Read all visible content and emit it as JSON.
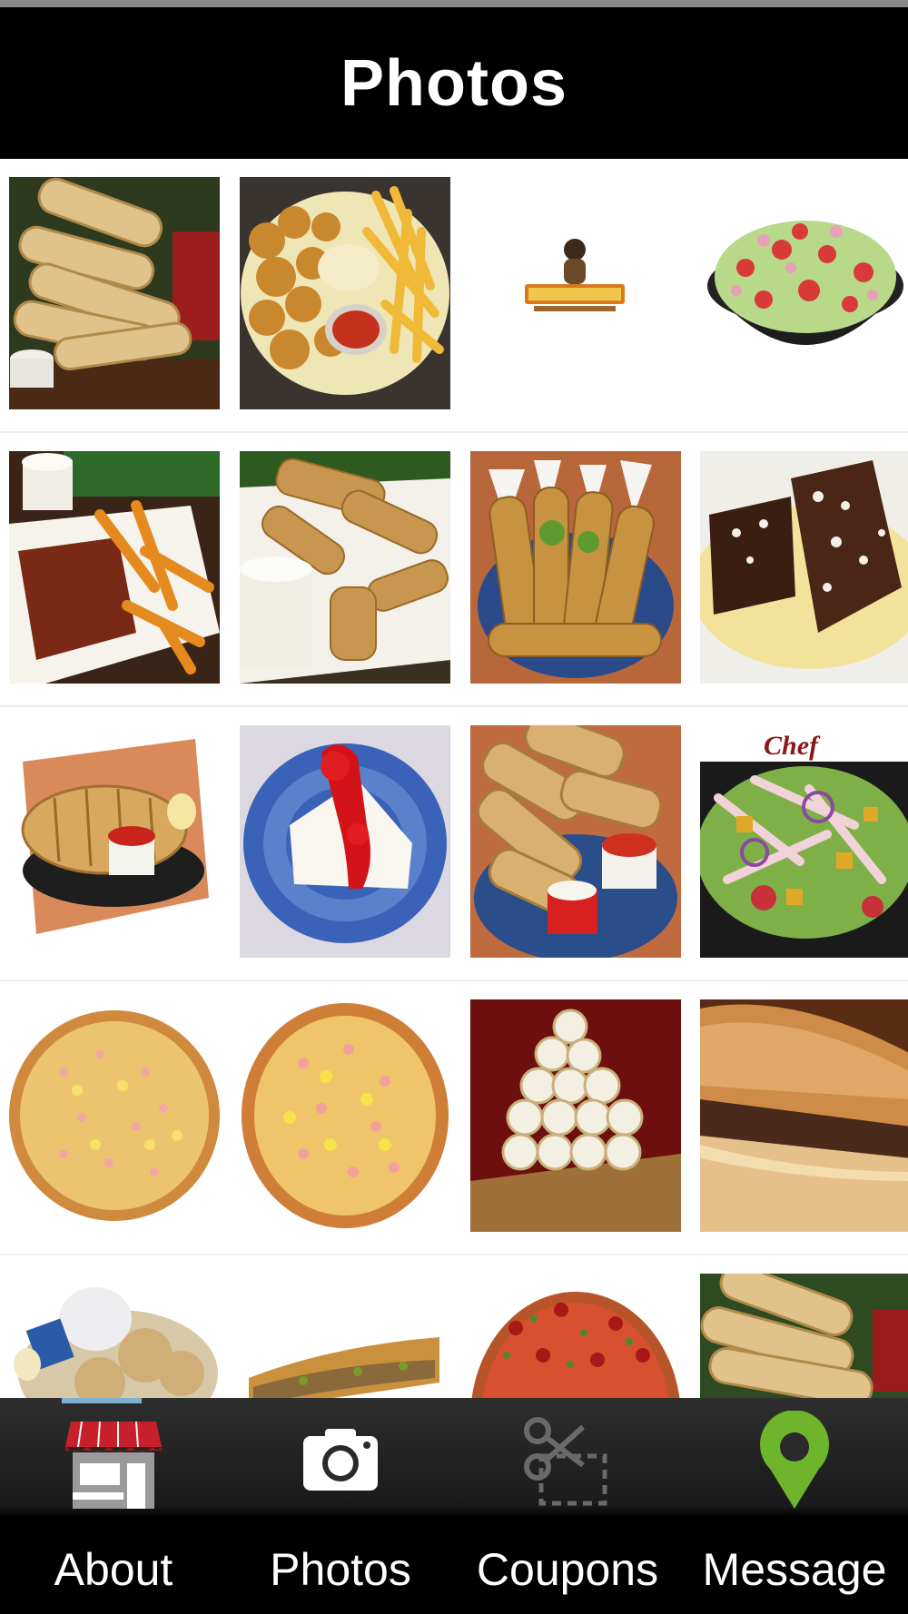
{
  "header": {
    "title": "Photos"
  },
  "tabbar": {
    "tabs": [
      {
        "id": "about",
        "label": "About",
        "icon": "storefront-icon"
      },
      {
        "id": "photos",
        "label": "Photos",
        "icon": "camera-icon",
        "selected": true
      },
      {
        "id": "coupons",
        "label": "Coupons",
        "icon": "scissors-coupon-icon"
      },
      {
        "id": "message",
        "label": "Message",
        "icon": "map-pin-icon"
      }
    ]
  },
  "photos": [
    {
      "subject": "breadsticks"
    },
    {
      "subject": "fried-shrimp-and-fries"
    },
    {
      "subject": "restaurant-logo"
    },
    {
      "subject": "bowl-salad"
    },
    {
      "subject": "ribs-and-fries"
    },
    {
      "subject": "fried-fish-and-chips"
    },
    {
      "subject": "chicken-tenders"
    },
    {
      "subject": "brownies"
    },
    {
      "subject": "garlic-bread"
    },
    {
      "subject": "cheesecake"
    },
    {
      "subject": "cheese-sticks"
    },
    {
      "subject": "chef-salad",
      "caption": "Chef"
    },
    {
      "subject": "cheese-pizza"
    },
    {
      "subject": "pineapple-pizza"
    },
    {
      "subject": "pinwheel-rolls"
    },
    {
      "subject": "cheesesteak-sub"
    },
    {
      "subject": "wings-with-dip"
    },
    {
      "subject": "sub-sandwich"
    },
    {
      "subject": "supreme-pizza"
    },
    {
      "subject": "breadsticks-2"
    }
  ],
  "colors": {
    "header_bg": "#000000",
    "accent_pin": "#6fb52c",
    "awning_red": "#c8202a"
  }
}
